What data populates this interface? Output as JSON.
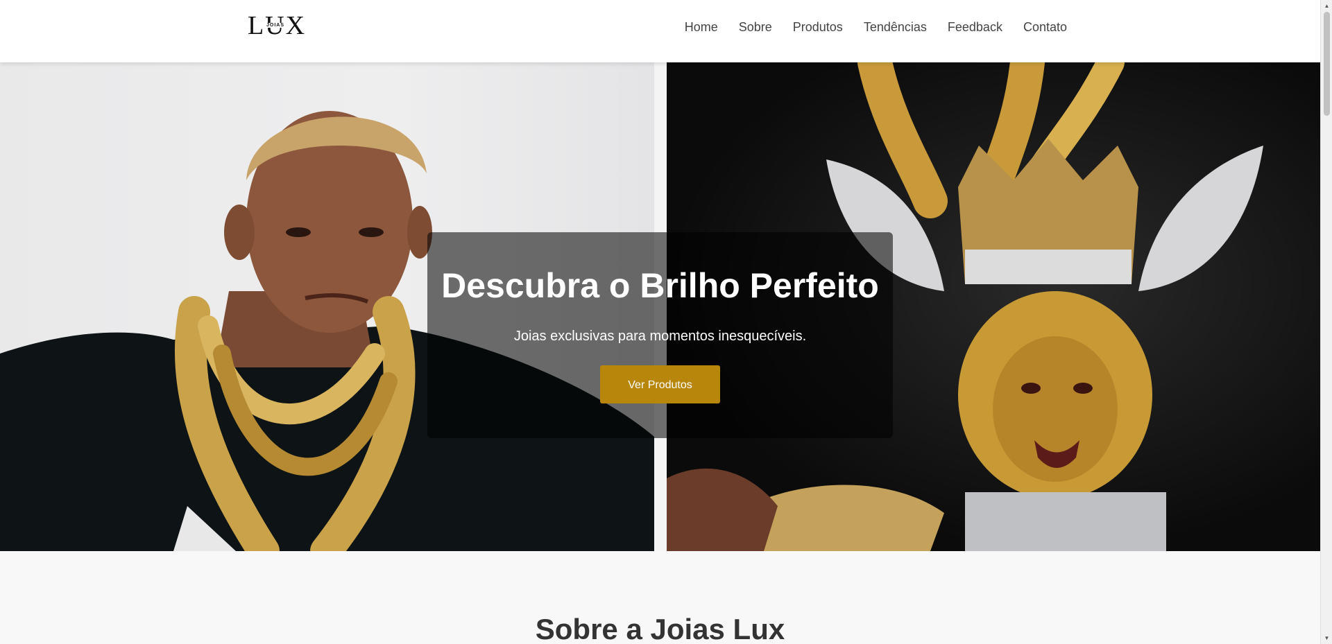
{
  "header": {
    "logo_text": "LUX",
    "logo_subtext": "JOIAS",
    "nav": [
      {
        "label": "Home"
      },
      {
        "label": "Sobre"
      },
      {
        "label": "Produtos"
      },
      {
        "label": "Tendências"
      },
      {
        "label": "Feedback"
      },
      {
        "label": "Contato"
      }
    ]
  },
  "hero": {
    "title": "Descubra o Brilho Perfeito",
    "subtitle": "Joias exclusivas para momentos inesquecíveis.",
    "cta_label": "Ver Produtos",
    "cta_color": "#b8860b"
  },
  "about": {
    "title": "Sobre a Joias Lux"
  }
}
